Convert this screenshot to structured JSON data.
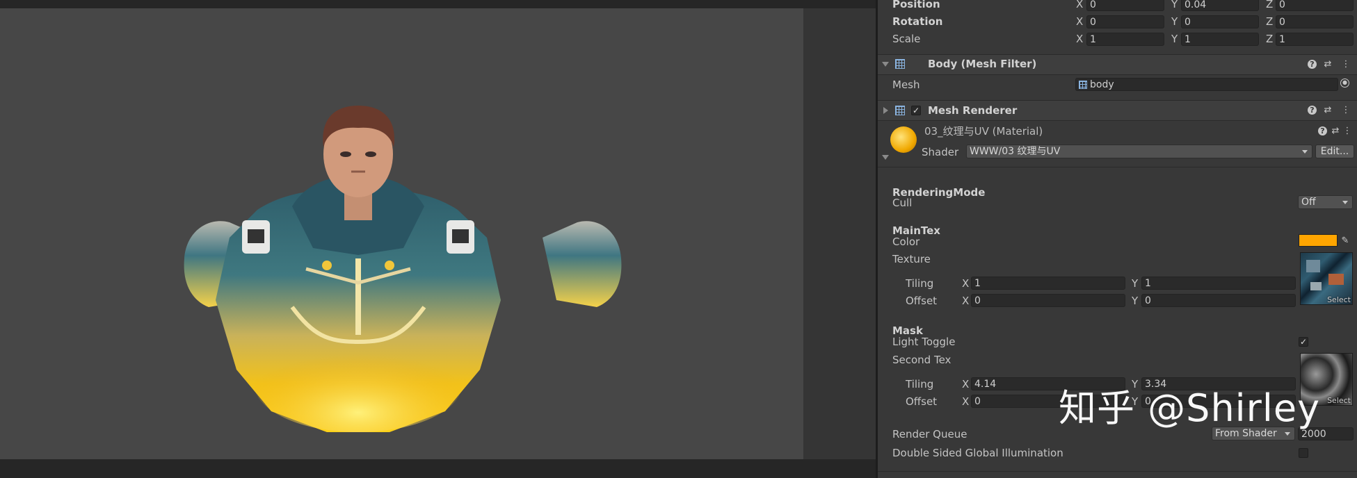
{
  "transform": {
    "position": {
      "label": "Position",
      "x": "0",
      "y": "0.04",
      "z": "0"
    },
    "rotation": {
      "label": "Rotation",
      "x": "0",
      "y": "0",
      "z": "0"
    },
    "scale": {
      "label": "Scale",
      "x": "1",
      "y": "1",
      "z": "1"
    },
    "axis_x": "X",
    "axis_y": "Y",
    "axis_z": "Z"
  },
  "mesh_filter": {
    "title": "Body (Mesh Filter)",
    "mesh_label": "Mesh",
    "mesh_value": "body"
  },
  "mesh_renderer": {
    "title": "Mesh Renderer",
    "enabled": true
  },
  "material": {
    "title": "03_纹理与UV (Material)",
    "shader_label": "Shader",
    "shader_value": "WWW/03 纹理与UV",
    "edit_button": "Edit..."
  },
  "properties": {
    "rendering_mode": "RenderingMode",
    "cull_label": "Cull",
    "cull_value": "Off",
    "main_tex": "MainTex",
    "color_label": "Color",
    "color_value": "#ffa500",
    "texture_label": "Texture",
    "tiling_label": "Tiling",
    "offset_label": "Offset",
    "main_tiling": {
      "x": "1",
      "y": "1"
    },
    "main_offset": {
      "x": "0",
      "y": "0"
    },
    "select_label": "Select",
    "mask": "Mask",
    "light_toggle_label": "Light Toggle",
    "light_toggle_checked": true,
    "second_tex_label": "Second Tex",
    "second_tiling": {
      "x": "4.14",
      "y": "3.34"
    },
    "second_offset": {
      "x": "0",
      "y": "0"
    },
    "render_queue_label": "Render Queue",
    "render_queue_mode": "From Shader",
    "render_queue_value": "2000",
    "double_sided_gi_label": "Double Sided Global Illumination"
  },
  "watermark": "知乎 @Shirley",
  "colors": {
    "scene_bg": "#474747",
    "inspector_bg": "#383838",
    "accent_orange": "#ffa500"
  }
}
